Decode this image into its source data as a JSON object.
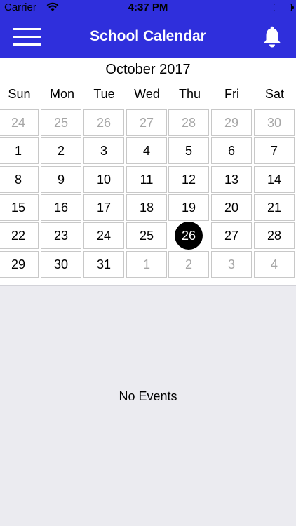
{
  "status": {
    "carrier": "Carrier",
    "time": "4:37 PM"
  },
  "nav": {
    "title": "School Calendar",
    "menu_icon": "hamburger-menu-icon",
    "bell_icon": "bell-icon"
  },
  "calendar": {
    "month_label": "October 2017",
    "weekdays": [
      "Sun",
      "Mon",
      "Tue",
      "Wed",
      "Thu",
      "Fri",
      "Sat"
    ],
    "weeks": [
      [
        {
          "d": "24",
          "other": true
        },
        {
          "d": "25",
          "other": true
        },
        {
          "d": "26",
          "other": true
        },
        {
          "d": "27",
          "other": true
        },
        {
          "d": "28",
          "other": true
        },
        {
          "d": "29",
          "other": true
        },
        {
          "d": "30",
          "other": true
        }
      ],
      [
        {
          "d": "1"
        },
        {
          "d": "2"
        },
        {
          "d": "3"
        },
        {
          "d": "4"
        },
        {
          "d": "5"
        },
        {
          "d": "6"
        },
        {
          "d": "7"
        }
      ],
      [
        {
          "d": "8"
        },
        {
          "d": "9"
        },
        {
          "d": "10"
        },
        {
          "d": "11"
        },
        {
          "d": "12"
        },
        {
          "d": "13"
        },
        {
          "d": "14"
        }
      ],
      [
        {
          "d": "15"
        },
        {
          "d": "16"
        },
        {
          "d": "17"
        },
        {
          "d": "18"
        },
        {
          "d": "19"
        },
        {
          "d": "20"
        },
        {
          "d": "21"
        }
      ],
      [
        {
          "d": "22"
        },
        {
          "d": "23"
        },
        {
          "d": "24"
        },
        {
          "d": "25"
        },
        {
          "d": "26",
          "selected": true
        },
        {
          "d": "27"
        },
        {
          "d": "28"
        }
      ],
      [
        {
          "d": "29"
        },
        {
          "d": "30"
        },
        {
          "d": "31"
        },
        {
          "d": "1",
          "other": true
        },
        {
          "d": "2",
          "other": true
        },
        {
          "d": "3",
          "other": true
        },
        {
          "d": "4",
          "other": true
        }
      ]
    ]
  },
  "events": {
    "empty_label": "No Events"
  },
  "colors": {
    "accent": "#2f2fdc",
    "selected": "#000000",
    "background": "#ebebf0"
  }
}
